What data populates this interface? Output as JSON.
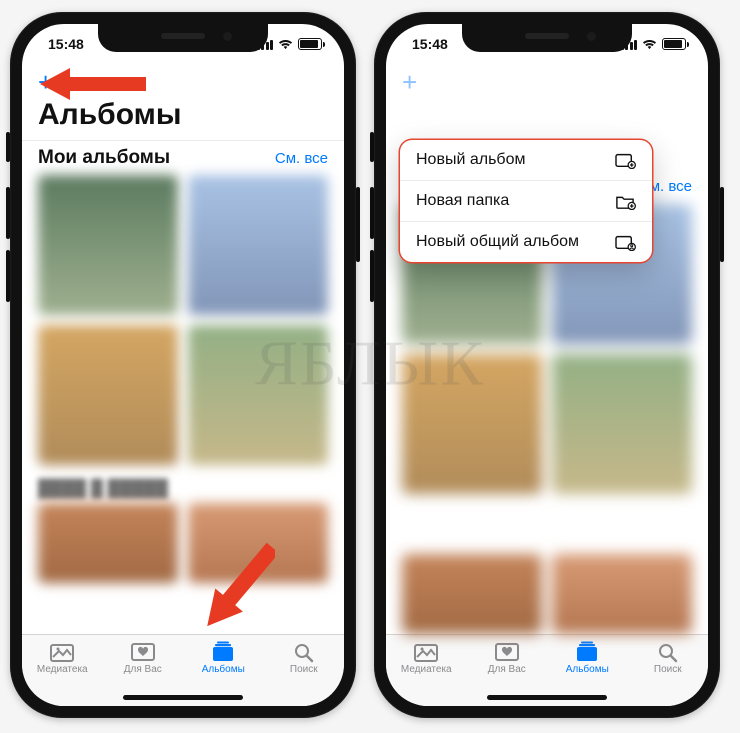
{
  "watermark": "ЯБЛЫК",
  "statusbar": {
    "time": "15:48"
  },
  "nav": {
    "plus": "+"
  },
  "large_title": "Альбомы",
  "section": {
    "title": "Мои альбомы",
    "see_all": "См. все"
  },
  "tabs": {
    "library": "Медиатека",
    "for_you": "Для Вас",
    "albums": "Альбомы",
    "search": "Поиск"
  },
  "ctx": {
    "new_album": "Новый альбом",
    "new_folder": "Новая папка",
    "new_shared": "Новый общий альбом"
  },
  "thumbs": {
    "c1": "#6b8a6e",
    "c2": "#a9bcd6",
    "c3": "#c7a36a",
    "c4": "#8aa982",
    "c5": "#e8c8a4",
    "c6": "#d8c4a0",
    "c7": "#b57f56",
    "c8": "#c98c6d"
  }
}
